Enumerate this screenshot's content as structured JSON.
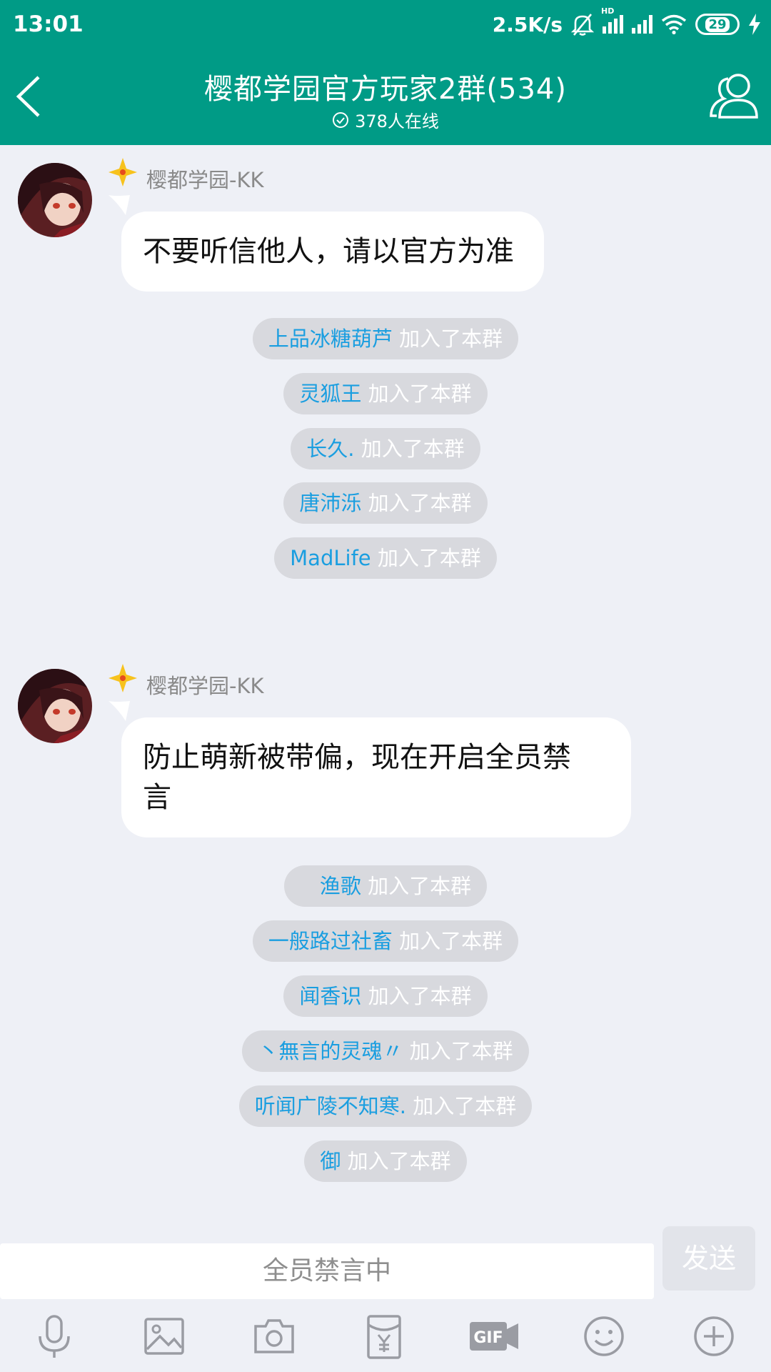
{
  "status_bar": {
    "time": "13:01",
    "network_speed": "2.5K/s",
    "hd_label": "HD",
    "battery": "29"
  },
  "header": {
    "title": "樱都学园官方玩家2群(534)",
    "online": "378人在线"
  },
  "messages": [
    {
      "sender": "樱都学园-KK",
      "lines": [
        "不要听信他人，请以官方为准"
      ]
    },
    {
      "sender": "樱都学园-KK",
      "lines": [
        "防止萌新被带偏，现在开启全员禁",
        "言"
      ]
    }
  ],
  "system_notices": [
    {
      "name": "上品冰糖葫芦",
      "action": " 加入了本群"
    },
    {
      "name": "灵狐王",
      "action": " 加入了本群"
    },
    {
      "name": "长久.",
      "action": " 加入了本群"
    },
    {
      "name": "唐沛泺",
      "action": " 加入了本群"
    },
    {
      "name": "MadLife",
      "action": " 加入了本群"
    },
    {
      "name": "渔歌",
      "action": " 加入了本群"
    },
    {
      "name": "一般路过社畜",
      "action": " 加入了本群"
    },
    {
      "name": "闻香识",
      "action": " 加入了本群"
    },
    {
      "name": "丶無言的灵魂〃",
      "action": " 加入了本群"
    },
    {
      "name": "听闻广陵不知寒.",
      "action": " 加入了本群"
    },
    {
      "name": "御",
      "action": " 加入了本群"
    }
  ],
  "input": {
    "placeholder": "全员禁言中",
    "send_label": "发送"
  },
  "toolbar": [
    "mic-icon",
    "image-icon",
    "camera-icon",
    "red-packet-icon",
    "gif-icon",
    "emoji-icon",
    "plus-icon"
  ],
  "colors": {
    "brand": "#009b86",
    "link": "#1a9ee0",
    "background": "#eef0f6"
  }
}
